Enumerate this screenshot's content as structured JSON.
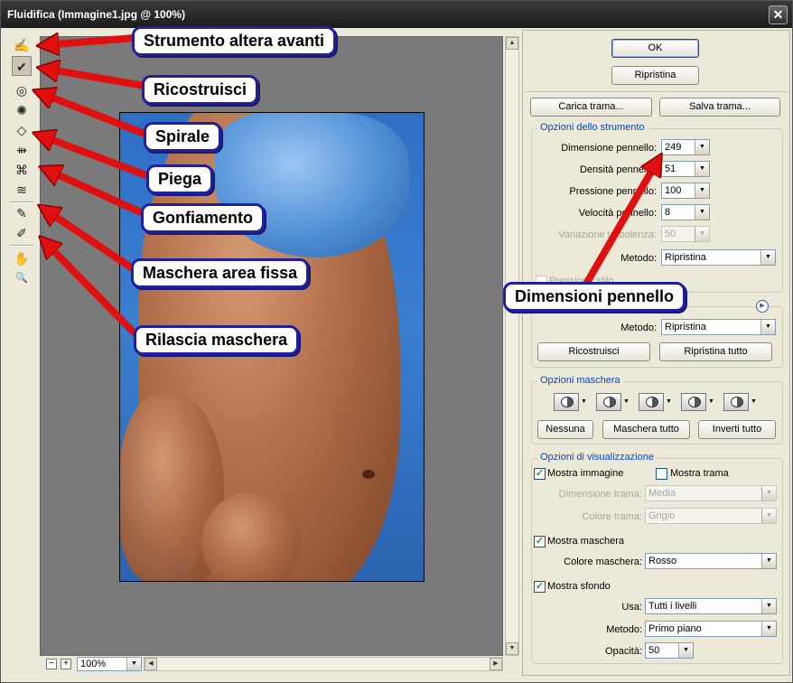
{
  "window": {
    "title": "Fluidifica (Immagine1.jpg @ 100%)",
    "close_symbol": "✕"
  },
  "tools": [
    {
      "name": "forward-warp-tool",
      "icon": "✍"
    },
    {
      "name": "reconstruct-tool",
      "icon": "✔"
    },
    {
      "name": "twirl-tool",
      "icon": "◎"
    },
    {
      "name": "pucker-tool",
      "icon": "✺"
    },
    {
      "name": "bloat-tool",
      "icon": "◇"
    },
    {
      "name": "push-left-tool",
      "icon": "⇻"
    },
    {
      "name": "mirror-tool",
      "icon": "⌘"
    },
    {
      "name": "turbulence-tool",
      "icon": "≋"
    },
    {
      "name": "freeze-mask-tool",
      "icon": "✎"
    },
    {
      "name": "thaw-mask-tool",
      "icon": "✐"
    },
    {
      "name": "hand-tool",
      "icon": "✋"
    },
    {
      "name": "zoom-tool",
      "icon": "🔍"
    }
  ],
  "zoom": {
    "minus": "−",
    "plus": "+",
    "value": "100%"
  },
  "panel": {
    "ok": "OK",
    "reset": "Ripristina",
    "load_mesh": "Carica trama...",
    "save_mesh": "Salva trama...",
    "tool_options": {
      "title": "Opzioni dello strumento",
      "brush_size": {
        "label": "Dimensione pennello:",
        "value": "249"
      },
      "brush_density": {
        "label": "Densità pennello:",
        "value": "51"
      },
      "brush_pressure": {
        "label": "Pressione pennello:",
        "value": "100"
      },
      "brush_rate": {
        "label": "Velocità pennello:",
        "value": "8"
      },
      "turbulent_jitter": {
        "label": "Variazione turbolenza:",
        "value": "50"
      },
      "mode": {
        "label": "Metodo:",
        "value": "Ripristina"
      },
      "stylus_pressure": "Pressione stilo"
    },
    "reconstruct": {
      "mode": {
        "label": "Metodo:",
        "value": "Ripristina"
      },
      "reconstruct_btn": "Ricostruisci",
      "restore_all_btn": "Ripristina tutto"
    },
    "mask_options": {
      "title": "Opzioni maschera",
      "none": "Nessuna",
      "mask_all": "Maschera tutto",
      "invert_all": "Inverti tutto"
    },
    "view_options": {
      "title": "Opzioni di visualizzazione",
      "show_image": "Mostra immagine",
      "show_mesh": "Mostra trama",
      "mesh_size": {
        "label": "Dimensione trama:",
        "value": "Media"
      },
      "mesh_color": {
        "label": "Colore trama:",
        "value": "Grigio"
      },
      "show_mask": "Mostra maschera",
      "mask_color": {
        "label": "Colore maschera:",
        "value": "Rosso"
      },
      "show_backdrop": "Mostra sfondo",
      "use": {
        "label": "Usa:",
        "value": "Tutti i livelli"
      },
      "mode": {
        "label": "Metodo:",
        "value": "Primo piano"
      },
      "opacity": {
        "label": "Opacità:",
        "value": "50"
      }
    }
  },
  "callouts": {
    "forward_warp": "Strumento altera avanti",
    "reconstruct": "Ricostruisci",
    "twirl": "Spirale",
    "fold": "Piega",
    "bloat": "Gonfiamento",
    "freeze_mask": "Maschera area fissa",
    "thaw_mask": "Rilascia maschera",
    "brush_size": "Dimensioni pennello"
  },
  "colors": {
    "arrow": "#e01010",
    "callout_border": "#1f1fa0",
    "group_title": "#0046d5"
  }
}
